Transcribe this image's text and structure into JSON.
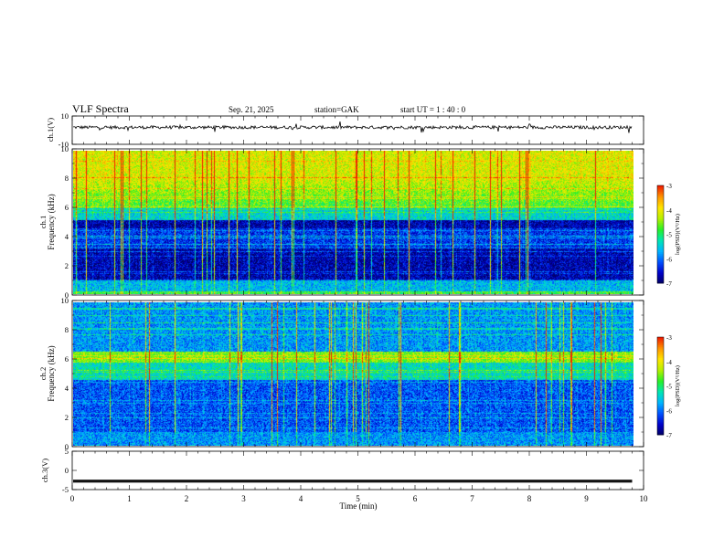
{
  "header": {
    "title": "VLF  Spectra",
    "date": "Sep. 21, 2025",
    "station": "station=GAK",
    "start": "start  UT  =    1  : 40 : 0"
  },
  "chart_data": [
    {
      "type": "line",
      "panel": "ch1-waveform",
      "ylabel": "ch.1(V)",
      "ylim": [
        -10,
        10
      ],
      "yticks": [
        "10",
        "-10"
      ],
      "xlim": [
        0,
        10
      ],
      "series": [
        {
          "values_description_level": 2,
          "x_end": 9.8
        }
      ]
    },
    {
      "type": "heatmap",
      "panel": "ch1-spectrogram",
      "ylabel": [
        "ch.1",
        "Frequency  (kHz)"
      ],
      "ylim": [
        0,
        10
      ],
      "yticks": [
        "0",
        "2",
        "4",
        "6",
        "8",
        "10"
      ],
      "xlim": [
        0,
        10
      ],
      "colorbar": {
        "label": "log(PSD)(V²/Hz)",
        "range": [
          -7,
          -3
        ],
        "ticks": [
          "-3",
          "-4",
          "-5",
          "-6",
          "-7"
        ]
      }
    },
    {
      "type": "heatmap",
      "panel": "ch2-spectrogram",
      "ylabel": [
        "ch.2",
        "Frequency  (kHz)"
      ],
      "ylim": [
        0,
        10
      ],
      "yticks": [
        "0",
        "2",
        "4",
        "6",
        "8",
        "10"
      ],
      "xlim": [
        0,
        10
      ],
      "colorbar": {
        "label": "log(PSD)(V²/Hz)",
        "range": [
          -7,
          -3
        ],
        "ticks": [
          "-3",
          "-4",
          "-5",
          "-6",
          "-7"
        ]
      }
    },
    {
      "type": "line",
      "panel": "ch3-waveform",
      "ylabel": "ch.3(V)",
      "ylim": [
        -5,
        5
      ],
      "yticks": [
        "5",
        "0",
        "-5"
      ],
      "xlim": [
        0,
        10
      ],
      "series": [
        {
          "level": -2.8,
          "x_end": 9.8
        }
      ]
    }
  ],
  "xaxis": {
    "label": "Time  (min)",
    "ticks": [
      "0",
      "1",
      "2",
      "3",
      "4",
      "5",
      "6",
      "7",
      "8",
      "9",
      "10"
    ]
  },
  "colors": {
    "scale": [
      "#000060",
      "#0000c8",
      "#0050ff",
      "#00b4ff",
      "#00e6b4",
      "#28f028",
      "#b4f000",
      "#ffe600",
      "#ff9600",
      "#f01e00",
      "#ffffff"
    ]
  }
}
